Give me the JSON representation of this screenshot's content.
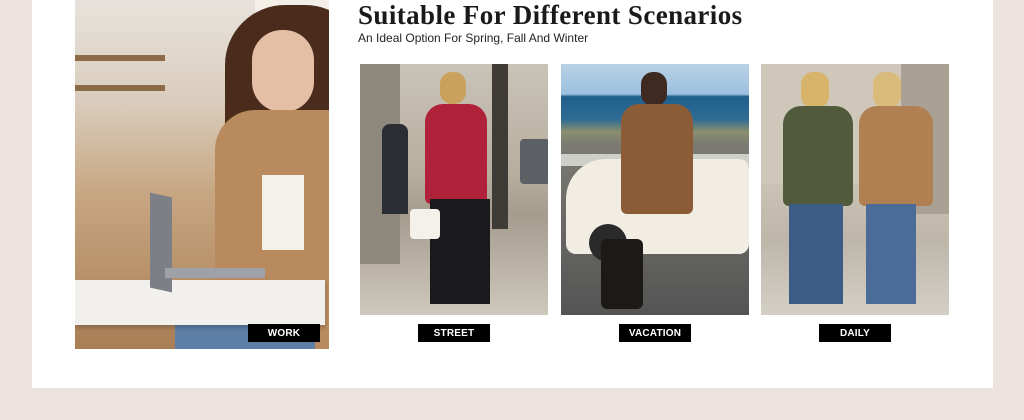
{
  "header": {
    "title": "Suitable For Different Scenarios",
    "subtitle": "An Ideal Option For Spring, Fall And Winter"
  },
  "scenarios": [
    {
      "label": "WORK"
    },
    {
      "label": "STREET"
    },
    {
      "label": "VACATION"
    },
    {
      "label": "DAILY"
    }
  ],
  "colors": {
    "page_background": "#ece3de",
    "card_background": "#ffffff",
    "tag_background": "#000000",
    "tag_text": "#ffffff"
  }
}
